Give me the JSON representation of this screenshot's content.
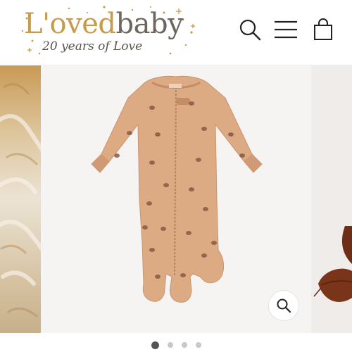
{
  "brand": {
    "name_part1": "L'oved",
    "name_part2": "baby",
    "tagline": "20 years of Love",
    "colors": {
      "gold": "#c69b4c",
      "gray": "#6d655e"
    }
  },
  "header": {
    "icons": [
      "search-icon",
      "menu-icon",
      "cart-icon"
    ]
  },
  "gallery": {
    "slides": [
      {
        "name": "fur-texture-slide"
      },
      {
        "name": "product-footed-sleeper-slide",
        "active": true
      },
      {
        "name": "dried-leaves-slide"
      }
    ],
    "zoom_icon": "zoom-icon",
    "pagination": {
      "total": 4,
      "current": 1
    }
  }
}
